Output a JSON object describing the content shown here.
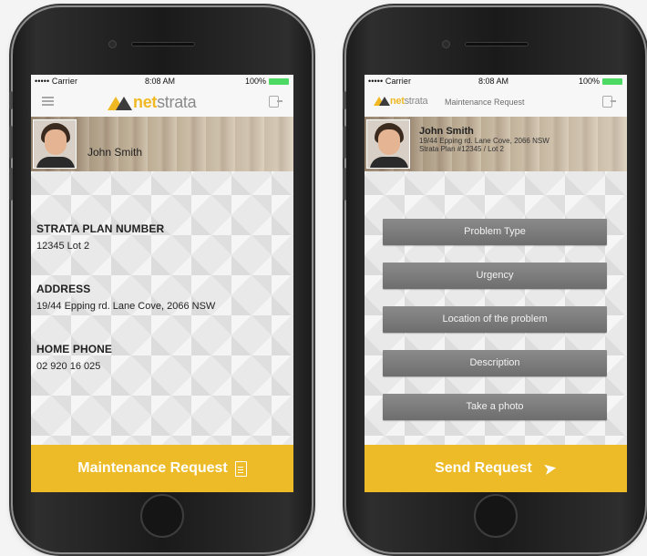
{
  "status_bar": {
    "carrier": "••••• Carrier",
    "time": "8:08 AM",
    "battery": "100%"
  },
  "brand": {
    "net": "net",
    "strata": "strata",
    "accent_color": "#ecbb27"
  },
  "left_screen": {
    "user_name": "John Smith",
    "fields": [
      {
        "label": "STRATA PLAN NUMBER",
        "value": "12345 Lot 2"
      },
      {
        "label": "ADDRESS",
        "value": "19/44 Epping rd. Lane Cove, 2066 NSW"
      },
      {
        "label": "HOME PHONE",
        "value": "02 920 16 025"
      }
    ],
    "footer_button": "Maintenance Request",
    "footer_icon": "document-icon"
  },
  "right_screen": {
    "nav_title": "Maintenance Request",
    "user_name": "John Smith",
    "address": "19/44 Epping rd. Lane Cove, 2066 NSW",
    "plan": "Strata Plan #12345 / Lot 2",
    "buttons": [
      "Problem Type",
      "Urgency",
      "Location of the problem",
      "Description",
      "Take a photo"
    ],
    "footer_button": "Send Request",
    "footer_icon": "send-icon"
  }
}
